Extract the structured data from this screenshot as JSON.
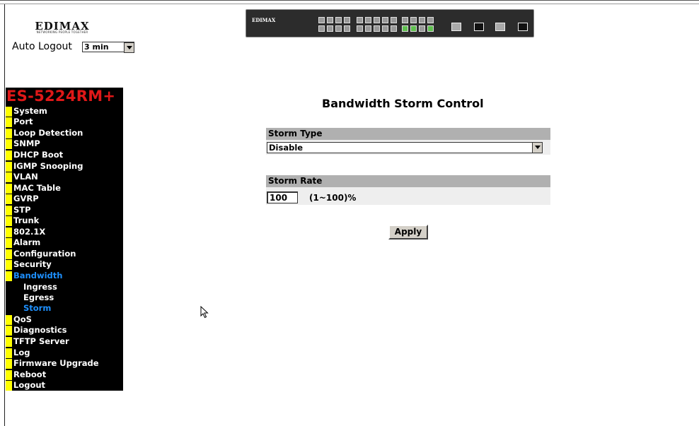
{
  "header": {
    "logo_text": "EDIMAX",
    "logo_tagline": "NETWORKING PEOPLE TOGETHER",
    "auto_logout_label": "Auto Logout",
    "auto_logout_value": "3 min",
    "switch_brand": "EDIMAX"
  },
  "sidebar": {
    "model": "ES-5224RM+",
    "items": [
      {
        "label": "System"
      },
      {
        "label": "Port"
      },
      {
        "label": "Loop Detection"
      },
      {
        "label": "SNMP"
      },
      {
        "label": "DHCP Boot"
      },
      {
        "label": "IGMP Snooping"
      },
      {
        "label": "VLAN"
      },
      {
        "label": "MAC Table"
      },
      {
        "label": "GVRP"
      },
      {
        "label": "STP"
      },
      {
        "label": "Trunk"
      },
      {
        "label": "802.1X"
      },
      {
        "label": "Alarm"
      },
      {
        "label": "Configuration"
      },
      {
        "label": "Security"
      },
      {
        "label": "Bandwidth"
      },
      {
        "label": "QoS"
      },
      {
        "label": "Diagnostics"
      },
      {
        "label": "TFTP Server"
      },
      {
        "label": "Log"
      },
      {
        "label": "Firmware Upgrade"
      },
      {
        "label": "Reboot"
      },
      {
        "label": "Logout"
      }
    ],
    "bandwidth_sub": [
      {
        "label": "Ingress"
      },
      {
        "label": "Egress"
      },
      {
        "label": "Storm"
      }
    ]
  },
  "main": {
    "title": "Bandwidth Storm Control",
    "storm_type_label": "Storm Type",
    "storm_type_value": "Disable",
    "storm_rate_label": "Storm Rate",
    "storm_rate_value": "100",
    "storm_rate_range": "(1~100)%",
    "apply_label": "Apply"
  },
  "colors": {
    "sidebar_bg": "#000000",
    "model_color": "#e01818",
    "active_color": "#1e90ff",
    "bullet_color": "#ffff00",
    "panel_header": "#b0b0b0"
  }
}
